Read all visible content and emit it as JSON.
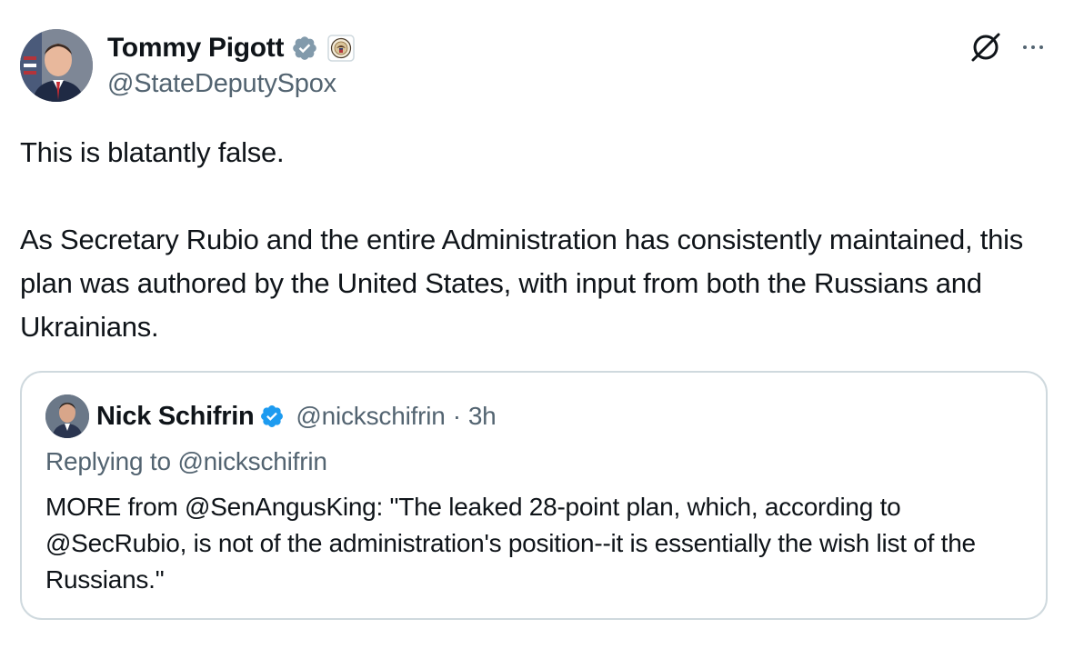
{
  "author": {
    "name": "Tommy Pigott",
    "handle": "@StateDeputySpox",
    "verified_color": "#829aab"
  },
  "tweet": {
    "paragraphs": [
      "This is blatantly false.",
      "As Secretary Rubio and the entire Administration has consistently maintained, this plan was authored by the United States, with input from both the Russians and Ukrainians."
    ]
  },
  "quoted": {
    "name": "Nick Schifrin",
    "handle": "@nickschifrin",
    "separator": "·",
    "time": "3h",
    "replying_to": "Replying to @nickschifrin",
    "text": "MORE from @SenAngusKing: \"The leaked 28-point plan, which, according to @SecRubio, is not of the administration's position--it is essentially the wish list of the Russians.\"",
    "verified_color": "#1d9bf0"
  },
  "icons": {
    "grok": "grok-icon",
    "more": "more-icon",
    "verified": "verified-badge-icon",
    "affiliate": "state-department-seal-icon"
  }
}
